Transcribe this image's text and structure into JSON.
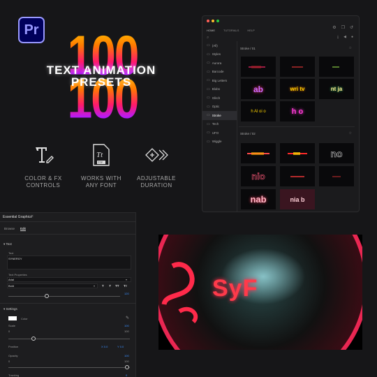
{
  "promo": {
    "app_logo": "Pr",
    "headline_number": "100",
    "headline_line1": "TEXT ANIMATION",
    "headline_line2": "PRESETS",
    "features": [
      {
        "line1": "COLOR & FX",
        "line2": "CONTROLS",
        "icon": "text-color-fx-icon"
      },
      {
        "line1": "WORKS WITH",
        "line2": "ANY FONT",
        "icon": "ttf-font-file-icon"
      },
      {
        "line1": "ADJUSTABLE",
        "line2": "DURATION",
        "icon": "duration-chevrons-icon"
      }
    ]
  },
  "preset_window": {
    "nav": [
      "HOME",
      "TUTORIALS",
      "HELP"
    ],
    "categories": [
      "(All)",
      "Styles",
      "Aurora",
      "Barcode",
      "Big Letters",
      "Blobs",
      "Glitch",
      "Optic",
      "Stroke",
      "Tech",
      "UFO",
      "Wiggle"
    ],
    "active_category": "Stroke",
    "groups": [
      {
        "label": "Stroke / 01",
        "thumbs": [
          "",
          "",
          "",
          "ab",
          "wri tv",
          "nt ja",
          "h Al oi o",
          "h o"
        ]
      },
      {
        "label": "Stroke / 02",
        "thumbs": [
          "",
          "",
          "no",
          "nio",
          "",
          "",
          "nab",
          "nia b"
        ]
      }
    ]
  },
  "essential_graphics": {
    "panel_title": "Essential Graphics",
    "tabs": [
      "Browse",
      "Edit"
    ],
    "active_tab": "Edit",
    "text_section": "Text",
    "text_label": "Text",
    "text_value": "SYNERGY",
    "text_properties_label": "Text Properties",
    "font_family": "Arial",
    "font_style": "Bold",
    "style_buttons": [
      "T",
      "T",
      "TT",
      "Tт"
    ],
    "font_size": "120",
    "settings_section": "Settings",
    "color_label": "Color",
    "scale_label": "Scale",
    "scale_min": "0",
    "scale_value": "100",
    "scale_max": "100",
    "position_label": "Position",
    "position_x": "X 0.0",
    "position_y": "Y 0.0",
    "opacity_label": "Opacity",
    "opacity_min": "0",
    "opacity_value": "100",
    "opacity_max": "100",
    "tracking_label": "Tracking",
    "tracking_value": "0"
  },
  "preview": {
    "visible_text": "SyF"
  },
  "colors": {
    "pr_bg": "#00005b",
    "pr_accent": "#9999ff",
    "value_blue": "#3a8fff",
    "neon_pink": "#ff2a6a"
  }
}
